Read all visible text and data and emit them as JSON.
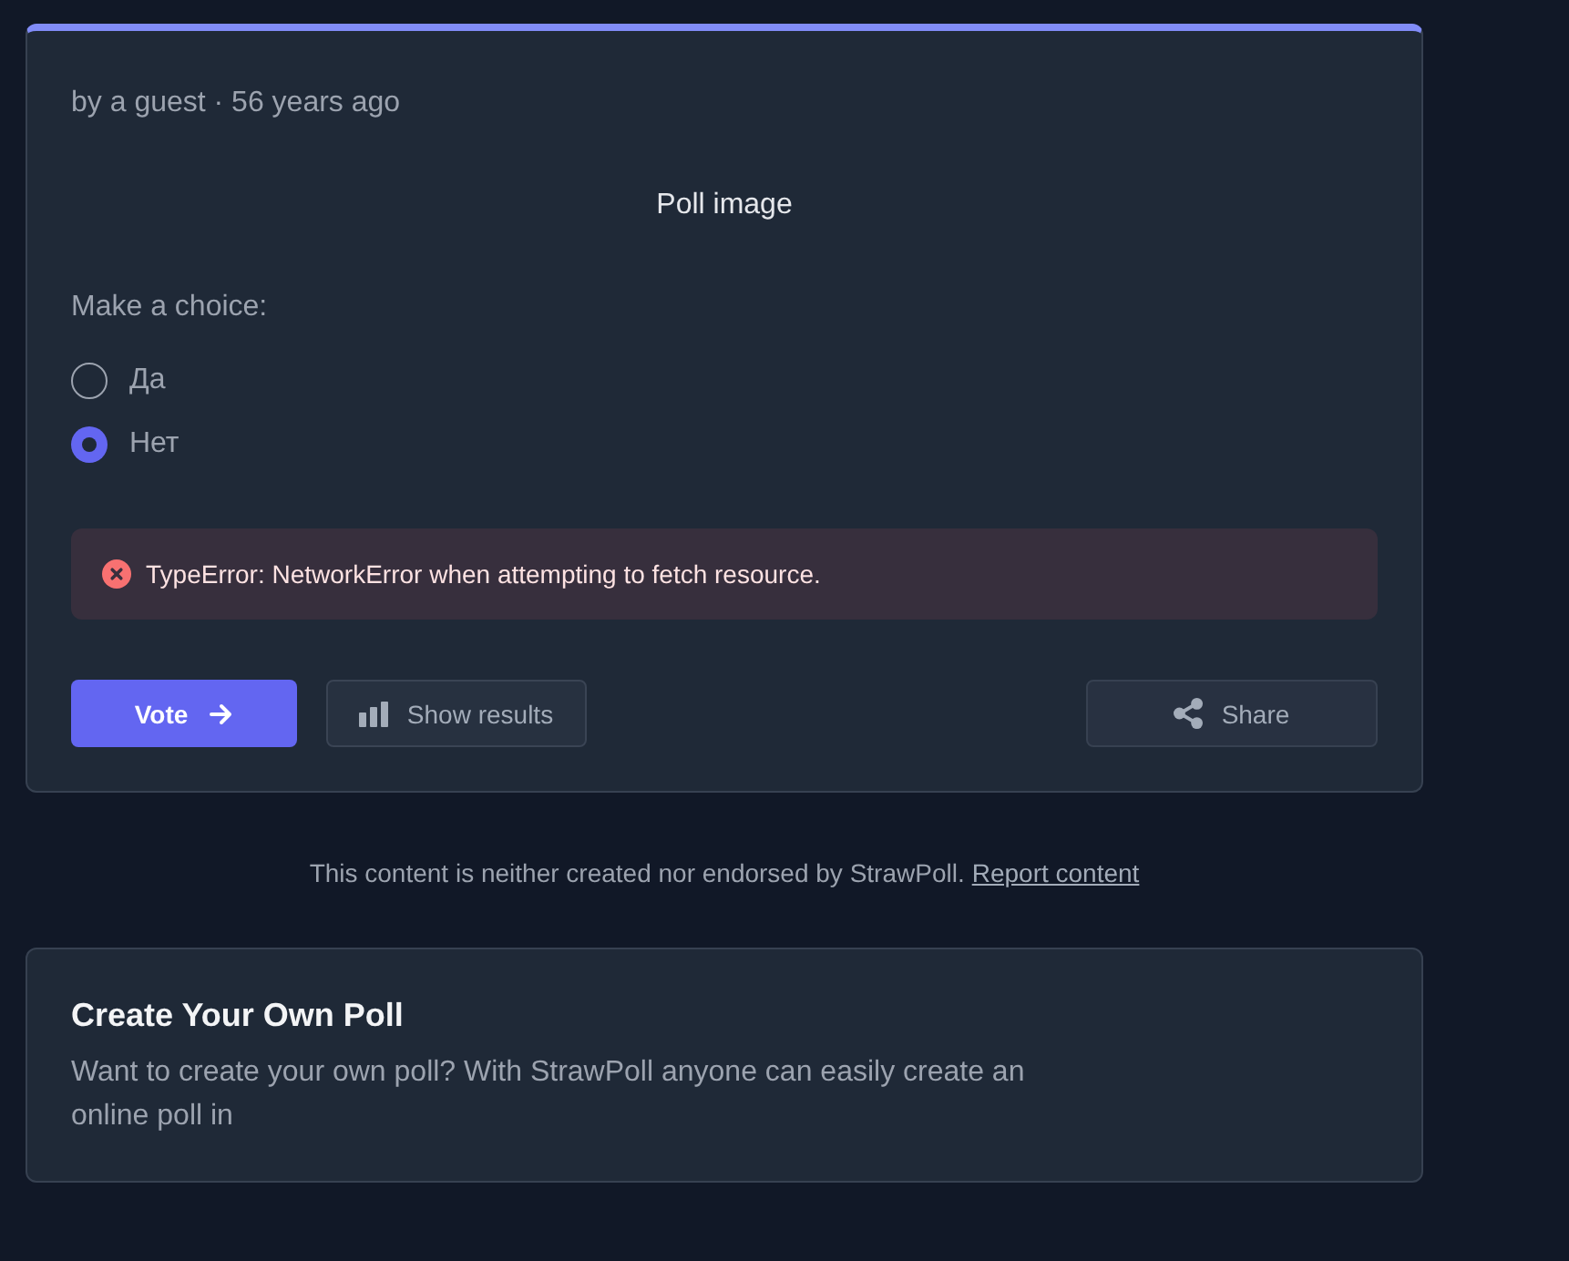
{
  "poll": {
    "meta": "by a guest · 56 years ago",
    "image_label": "Poll image",
    "prompt": "Make a choice:",
    "options": [
      {
        "label": "Да",
        "selected": false
      },
      {
        "label": "Нет",
        "selected": true
      }
    ],
    "error": {
      "message": "TypeError: NetworkError when attempting to fetch resource."
    },
    "buttons": [
      {
        "kind": "primary",
        "label": "Vote"
      },
      {
        "kind": "secondary",
        "label": "Show results"
      },
      {
        "kind": "share",
        "label": "Share"
      }
    ]
  },
  "disclaimer": {
    "text": "This content is neither created nor endorsed by StrawPoll.",
    "link": "Report content"
  },
  "promo": {
    "title": "Create Your Own Poll",
    "text": "Want to create your own poll? With StrawPoll anyone can easily create an online poll in"
  }
}
